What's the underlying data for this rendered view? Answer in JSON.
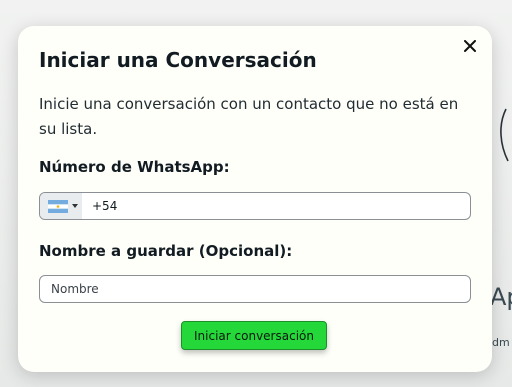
{
  "background": {
    "partial_text_large": "Ap",
    "partial_text_small": "dm"
  },
  "modal": {
    "title": "Iniciar una Conversación",
    "description": "Inicie una conversación con un contacto que no está en su lista.",
    "close_icon": "close-icon",
    "phone": {
      "label": "Número de WhatsApp:",
      "country_flag_icon": "argentina-flag-icon",
      "value": "+54"
    },
    "name": {
      "label": "Nombre a guardar (Opcional):",
      "placeholder": "Nombre",
      "value": ""
    },
    "submit_label": "Iniciar conversación"
  },
  "colors": {
    "submit_button": "#25d83a",
    "modal_background": "#fffffa",
    "flag_blue": "#74acdf"
  }
}
